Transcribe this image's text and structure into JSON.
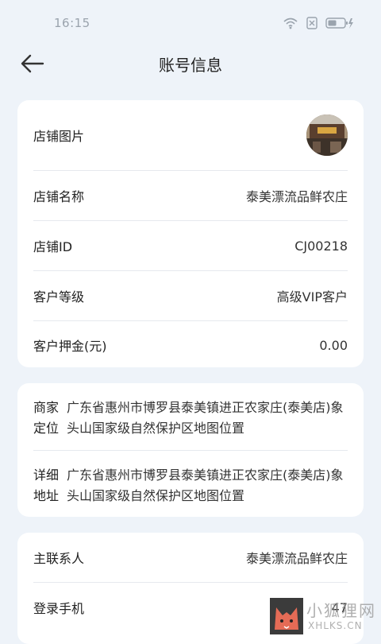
{
  "status": {
    "time": "16:15"
  },
  "header": {
    "title": "账号信息"
  },
  "store_card": {
    "image_label": "店铺图片",
    "name_label": "店铺名称",
    "name_value": "泰美漂流品鲜农庄",
    "id_label": "店铺ID",
    "id_value": "CJ00218",
    "level_label": "客户等级",
    "level_value": "高级VIP客户",
    "deposit_label": "客户押金(元)",
    "deposit_value": "0.00"
  },
  "address_card": {
    "merchant_loc_label": "商家定位",
    "merchant_loc_value": "广东省惠州市博罗县泰美镇进正农家庄(泰美店)象头山国家级自然保护区地图位置",
    "detail_addr_label": "详细地址",
    "detail_addr_value": "广东省惠州市博罗县泰美镇进正农家庄(泰美店)象头山国家级自然保护区地图位置"
  },
  "contact_card": {
    "contact_label": "主联系人",
    "contact_value": "泰美漂流品鲜农庄",
    "phone_label": "登录手机",
    "phone_value": "47"
  },
  "watermark": {
    "text_cn": "小狐狸网",
    "text_en": "XHLKS.CN"
  },
  "colors": {
    "background": "#eef3f9",
    "card": "#ffffff",
    "divider": "#e6e9ee"
  }
}
